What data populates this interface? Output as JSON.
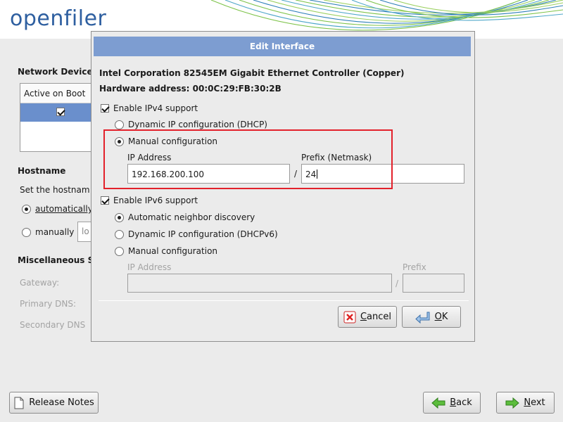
{
  "header": {
    "logo": "openfiler"
  },
  "network_devices": {
    "heading": "Network Devices",
    "column_header": "Active on Boot",
    "row_active": true
  },
  "hostname": {
    "heading": "Hostname",
    "description": "Set the hostnam",
    "automatic_label": "automatically",
    "manual_label": "manually",
    "manual_value": "lo",
    "selected": "automatic"
  },
  "misc": {
    "heading": "Miscellaneous S",
    "gateway_label": "Gateway:",
    "primary_dns_label": "Primary DNS:",
    "secondary_dns_label": "Secondary DNS"
  },
  "footer": {
    "release_notes_label": "Release Notes",
    "back_label": "Back",
    "next_label": "Next"
  },
  "dialog": {
    "title": "Edit Interface",
    "device_name": "Intel Corporation 82545EM Gigabit Ethernet Controller (Copper)",
    "hardware_address": "Hardware address: 00:0C:29:FB:30:2B",
    "ipv4": {
      "enable_label": "Enable IPv4 support",
      "enabled": true,
      "dhcp_label": "Dynamic IP configuration (DHCP)",
      "manual_label": "Manual configuration",
      "selected": "manual",
      "ip_label": "IP Address",
      "ip_value": "192.168.200.100",
      "separator": "/",
      "prefix_label": "Prefix (Netmask)",
      "prefix_value": "24"
    },
    "ipv6": {
      "enable_label": "Enable IPv6 support",
      "enabled": true,
      "auto_label": "Automatic neighbor discovery",
      "dhcp_label": "Dynamic IP configuration (DHCPv6)",
      "manual_label": "Manual configuration",
      "selected": "auto",
      "ip_label": "IP Address",
      "ip_value": "",
      "separator": "/",
      "prefix_label": "Prefix",
      "prefix_value": ""
    },
    "cancel_label": "Cancel",
    "ok_label": "OK"
  },
  "colors": {
    "titlebar": "#7d9dd1",
    "selection": "#6a8fcc",
    "highlight_box": "#e3212b",
    "logo": "#2e5fa0"
  },
  "icons": {
    "cancel": "red-x-icon",
    "ok": "enter-arrow-icon",
    "back": "green-left-arrow-icon",
    "next": "green-right-arrow-icon",
    "release_notes": "document-icon"
  }
}
